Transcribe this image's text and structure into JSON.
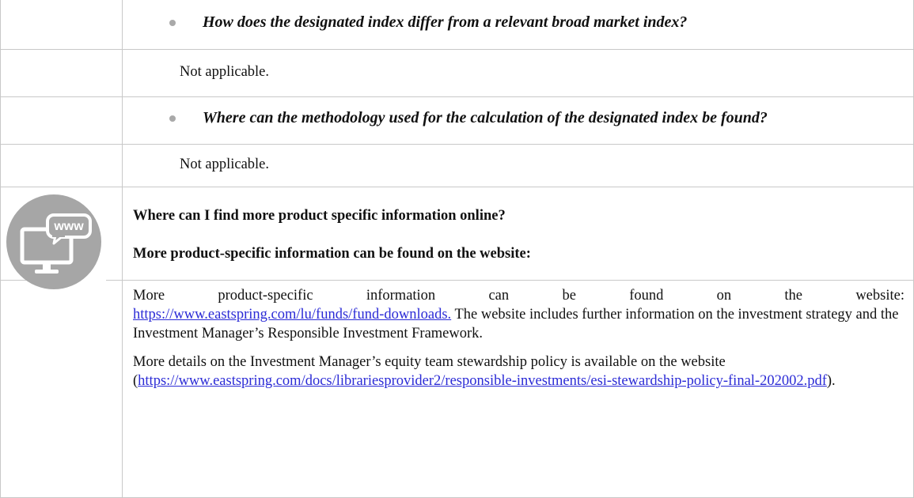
{
  "questions": {
    "q1": "How does the designated index differ from a relevant broad market index?",
    "a1": "Not applicable.",
    "q2": "Where can the methodology used for the calculation of the designated index be found?",
    "a2": "Not applicable."
  },
  "online_section": {
    "heading1": "Where can I find more product specific information online?",
    "heading2": "More product-specific information can be found on the website:",
    "icon_label": "www",
    "para1_words": [
      "More",
      "product-specific",
      "information",
      "can",
      "be",
      "found",
      "on",
      "the",
      "website:"
    ],
    "para1_link": "https://www.eastspring.com/lu/funds/fund-downloads.",
    "para1_rest": " The website includes further information on the investment strategy and the Investment Manager’s Responsible Investment Framework.",
    "para2_text": "More details on the Investment Manager’s equity team stewardship policy is available on the website (",
    "para2_link": "https://www.eastspring.com/docs/librariesprovider2/responsible-investments/esi-stewardship-policy-final-202002.pdf",
    "para2_end": ")."
  },
  "colors": {
    "icon_circle": "#a6a6a6",
    "bullet": "#a9a9a9",
    "rules": "#c8c8c8",
    "link": "#2b2bd6"
  }
}
